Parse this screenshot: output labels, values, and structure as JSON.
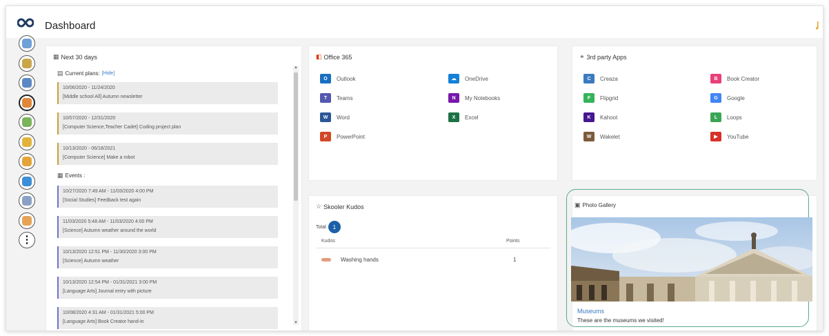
{
  "header": {
    "title": "Dashboard",
    "logo_icon": "infinity-icon"
  },
  "nav": {
    "items": [
      {
        "name": "profile-nav-icon",
        "color": "#6fa0d8"
      },
      {
        "name": "school-nav-icon",
        "color": "#c9a64a"
      },
      {
        "name": "classroom-nav-icon",
        "color": "#5b89c3"
      },
      {
        "name": "home-nav-icon",
        "color": "#e0873a"
      },
      {
        "name": "calendar-nav-icon",
        "color": "#7bb45b"
      },
      {
        "name": "assignment-nav-icon",
        "color": "#e2b33c"
      },
      {
        "name": "notes-nav-icon",
        "color": "#e5a43a"
      },
      {
        "name": "chat-nav-icon",
        "color": "#3b8fd6"
      },
      {
        "name": "date-nav-icon",
        "color": "#8aa0c6"
      },
      {
        "name": "people-nav-icon",
        "color": "#e6a356"
      }
    ],
    "more_label": "⋮"
  },
  "next30": {
    "title": "Next 30 days",
    "plans_label": "Current plans:",
    "hide_label": "[Hide]",
    "plans": [
      {
        "dates": "10/06/2020 - 11/24/2020",
        "text": "[Middle school All] Autumn newsletter"
      },
      {
        "dates": "10/07/2020 - 12/31/2020",
        "text": "[Computer Science,Teacher Cadet] Coding project plan"
      },
      {
        "dates": "10/13/2020 - 06/18/2021",
        "text": "[Computer Science] Make a robot"
      }
    ],
    "events_label": "Events :",
    "events": [
      {
        "dates": "10/27/2020 7:49 AM - 11/03/2020 4:00 PM",
        "text": "[Social Studies] Feedback test again"
      },
      {
        "dates": "11/03/2020 5:48 AM - 11/03/2020 4:00 PM",
        "text": "[Science] Autumn weather around the world"
      },
      {
        "dates": "10/13/2020 12:51 PM - 11/30/2020 3:00 PM",
        "text": "[Science] Autumn weather"
      },
      {
        "dates": "10/13/2020 12:54 PM - 01/31/2021 3:00 PM",
        "text": "[Language Arts] Journal entry with picture"
      },
      {
        "dates": "10/08/2020 4:31 AM - 01/31/2021 5:00 PM",
        "text": "[Language Arts] Book Creator hand-in"
      }
    ]
  },
  "office": {
    "title": "Office 365",
    "left": [
      {
        "label": "Outlook",
        "icon": "outlook-icon",
        "color": "#1b6fc1",
        "glyph": "O"
      },
      {
        "label": "Teams",
        "icon": "teams-icon",
        "color": "#5558af",
        "glyph": "T"
      },
      {
        "label": "Word",
        "icon": "word-icon",
        "color": "#2b5797",
        "glyph": "W"
      },
      {
        "label": "PowerPoint",
        "icon": "powerpoint-icon",
        "color": "#d24726",
        "glyph": "P"
      }
    ],
    "right": [
      {
        "label": "OneDrive",
        "icon": "onedrive-icon",
        "color": "#1480d8",
        "glyph": "☁"
      },
      {
        "label": "My Notebooks",
        "icon": "onenote-icon",
        "color": "#7719aa",
        "glyph": "N"
      },
      {
        "label": "Excel",
        "icon": "excel-icon",
        "color": "#1e7145",
        "glyph": "X"
      }
    ]
  },
  "apps": {
    "title": "3rd party Apps",
    "left": [
      {
        "label": "Creaza",
        "icon": "creaza-icon",
        "color": "#3b7bbf",
        "glyph": "C"
      },
      {
        "label": "Flipgrid",
        "icon": "flipgrid-icon",
        "color": "#36b35a",
        "glyph": "F"
      },
      {
        "label": "Kahoot",
        "icon": "kahoot-icon",
        "color": "#46178f",
        "glyph": "K"
      },
      {
        "label": "Wakelet",
        "icon": "wakelet-icon",
        "color": "#7a5c3c",
        "glyph": "W"
      }
    ],
    "right": [
      {
        "label": "Book Creator",
        "icon": "book-creator-icon",
        "color": "#e8407a",
        "glyph": "B"
      },
      {
        "label": "Google",
        "icon": "google-icon",
        "color": "#4285f4",
        "glyph": "G"
      },
      {
        "label": "Loops",
        "icon": "loops-icon",
        "color": "#3aa655",
        "glyph": "L"
      },
      {
        "label": "YouTube",
        "icon": "youtube-icon",
        "color": "#d8302b",
        "glyph": "▶"
      }
    ]
  },
  "kudos": {
    "title": "Skooler Kudos",
    "total_label": "Total",
    "total_value": "1",
    "col_kudos": "Kudos",
    "col_points": "Points",
    "rows": [
      {
        "name": "Washing hands",
        "points": "1"
      }
    ]
  },
  "gallery": {
    "title": "Photo Gallery",
    "caption": "Museums",
    "subtitle": "These are the museums we visited!"
  }
}
